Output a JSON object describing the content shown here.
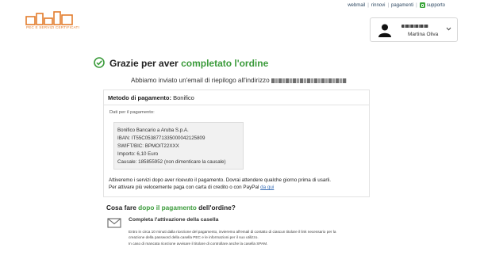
{
  "logo": {
    "name": "aruba-pec-logo",
    "text": "PEC E SERVIZI CERTIFICATI",
    "color": "#e37c2c"
  },
  "topnav": {
    "webmail": "webmail",
    "rinnovi": "rinnovi",
    "pagamenti": "pagamenti",
    "supporto": "supporto",
    "separator": "|"
  },
  "user": {
    "name": "Martina Oliva"
  },
  "header": {
    "title_prefix": "Grazie per aver ",
    "title_highlight": "completato l'ordine",
    "subtitle": "Abbiamo inviato un'email di riepilogo all'indirizzo"
  },
  "payment": {
    "label": "Metodo di pagamento:",
    "method": "Bonifico",
    "data_label": "Dati per il pagamento:",
    "bank_lines": [
      "Bonifico Bancario a Aruba S.p.A.",
      "IBAN: IT55C0538771335000042125809",
      "SWIFT/BIC: BPMOIT22XXX",
      "Importo: 6,10 Euro",
      "Causale: 185855952 (non dimenticare la causale)"
    ],
    "note1": "Attiveremo i servizi dopo aver ricevuto il pagamento. Dovrai attendere qualche giorno prima di usarli.",
    "note2_text": "Per attivare più velocemente paga con carta di credito o con PayPal ",
    "note2_link": "da qui"
  },
  "next": {
    "title_a": "Cosa fare ",
    "title_highlight": "dopo il pagamento",
    "title_b": " dell'ordine?",
    "step_title": "Completa l'attivazione della casella",
    "body": [
      "Entro in circa 10 minuti dalla ricezione del pagamento, invieremo all'email di contatto di ciascun titolare il link necessario per la",
      "creazione della password della casella PEC e le informazioni per il suo utilizzo.",
      "In caso di mancata ricezione avvisare il titolare di controllare anche la casella SPAM."
    ]
  },
  "colors": {
    "accent_green": "#3b9b3b",
    "link_blue": "#3a6fb7",
    "nav_text": "#2b4660"
  }
}
